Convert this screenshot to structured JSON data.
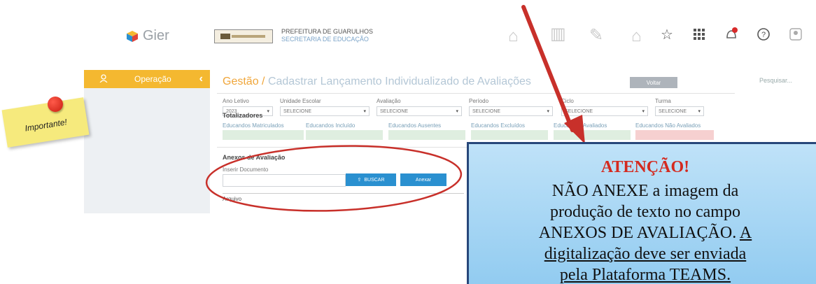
{
  "header": {
    "logo_text": "Gier",
    "prefeitura_line1": "PREFEITURA DE GUARULHOS",
    "prefeitura_line2": "SECRETARIA DE EDUCAÇÃO",
    "icons": [
      "star-icon",
      "grid-icon",
      "notification-icon",
      "help-icon",
      "user-icon",
      "phone-icon"
    ]
  },
  "sidebar": {
    "label": "Operação"
  },
  "breadcrumb": {
    "root": "Gestão /",
    "page": "Cadastrar Lançamento Individualizado de Avaliações"
  },
  "toolbar": {
    "voltar_label": "Voltar",
    "search_placeholder": "Pesquisar..."
  },
  "filters": [
    {
      "label": "Ano Letivo",
      "value": "2023"
    },
    {
      "label": "Unidade Escolar",
      "value": "SELECIONE"
    },
    {
      "label": "Avaliação",
      "value": "SELECIONE"
    },
    {
      "label": "Período",
      "value": "SELECIONE"
    },
    {
      "label": "Ciclo",
      "value": "SELECIONE"
    },
    {
      "label": "Turma",
      "value": "SELECIONE"
    }
  ],
  "totalizadores": {
    "title": "Totalizadores",
    "items": [
      "Educandos Matriculados",
      "Educandos Incluído",
      "Educandos Ausentes",
      "Educandos Excluídos",
      "Educandos Avaliados",
      "Educandos Não Avaliados"
    ]
  },
  "anexos": {
    "title": "Anexos de Avaliação",
    "input_label": "Inserir Documento",
    "buscar_label": "BUSCAR",
    "anexar_label": "Anexar",
    "arquivo_label": "Arquivo"
  },
  "sticky_note": "Importante!",
  "callout": {
    "title": "ATENÇÃO!",
    "line1": "NÃO ANEXE a imagem da",
    "line2": "produção de texto no campo",
    "line3a": "ANEXOS DE AVALIAÇÃO.",
    "line3b": "A",
    "line4": "digitalização deve ser enviada",
    "line5": "pela Plataforma TEAMS."
  },
  "colors": {
    "sidebar_accent": "#f4b830",
    "primary_button": "#2a90d0",
    "annotation_red": "#c8302a",
    "callout_border": "#27477a",
    "callout_title": "#d42a1f"
  }
}
